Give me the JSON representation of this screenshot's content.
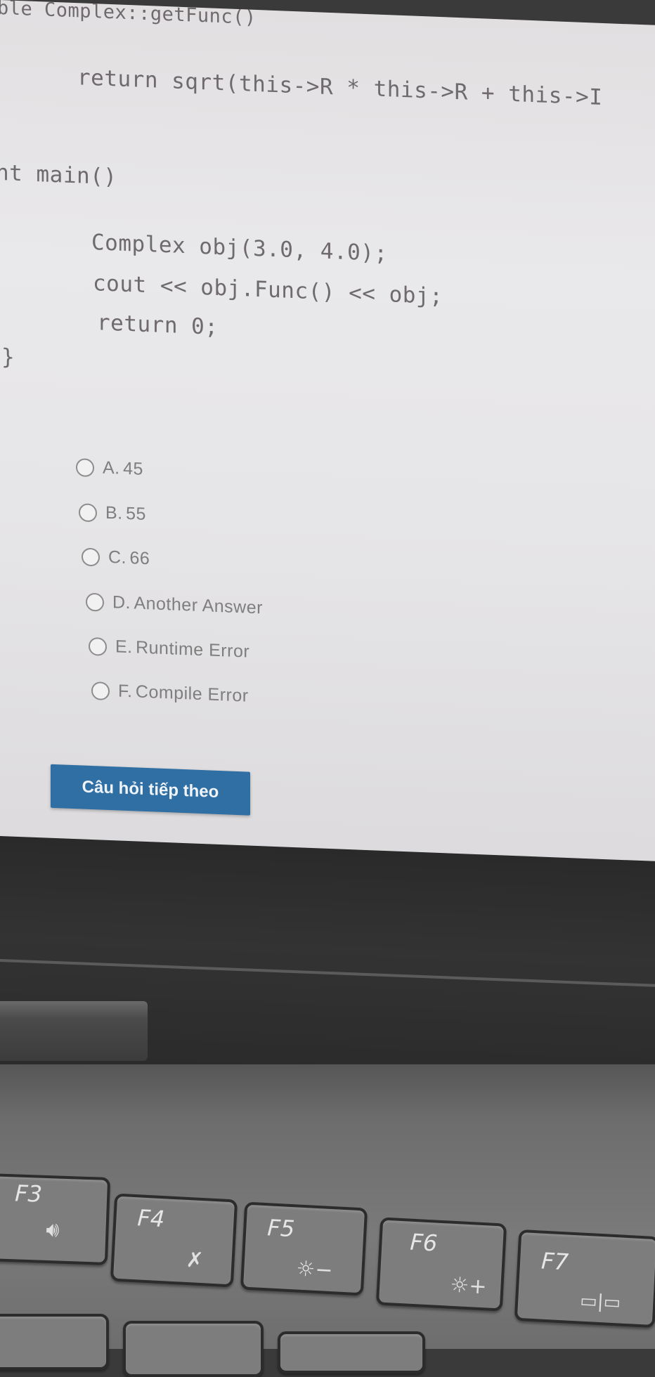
{
  "code": {
    "line1": "ble Complex::getFunc()",
    "line2": "return sqrt(this->R * this->R + this->I",
    "line3": "nt main()",
    "line4": "Complex obj(3.0, 4.0);",
    "line5": "cout << obj.Func() << obj;",
    "line6": "return 0;",
    "line7": "}"
  },
  "options": [
    {
      "letter": "A.",
      "text": "45"
    },
    {
      "letter": "B.",
      "text": "55"
    },
    {
      "letter": "C.",
      "text": "66"
    },
    {
      "letter": "D.",
      "text": "Another Answer"
    },
    {
      "letter": "E.",
      "text": "Runtime Error"
    },
    {
      "letter": "F.",
      "text": "Compile Error"
    }
  ],
  "next_button_label": "Câu hỏi tiếp theo",
  "keys": {
    "f3": "F3",
    "f4": "F4",
    "f5": "F5",
    "f6": "F6",
    "f7": "F7",
    "f3_icon": "volume-up-icon",
    "f4_icon": "microphone-mute-icon",
    "f5_icon": "brightness-down-icon",
    "f6_icon": "brightness-up-icon",
    "f7_icon": "display-switch-icon"
  },
  "colors": {
    "button_bg": "#2f6fa3",
    "screen_bg": "#e6e5e7"
  }
}
